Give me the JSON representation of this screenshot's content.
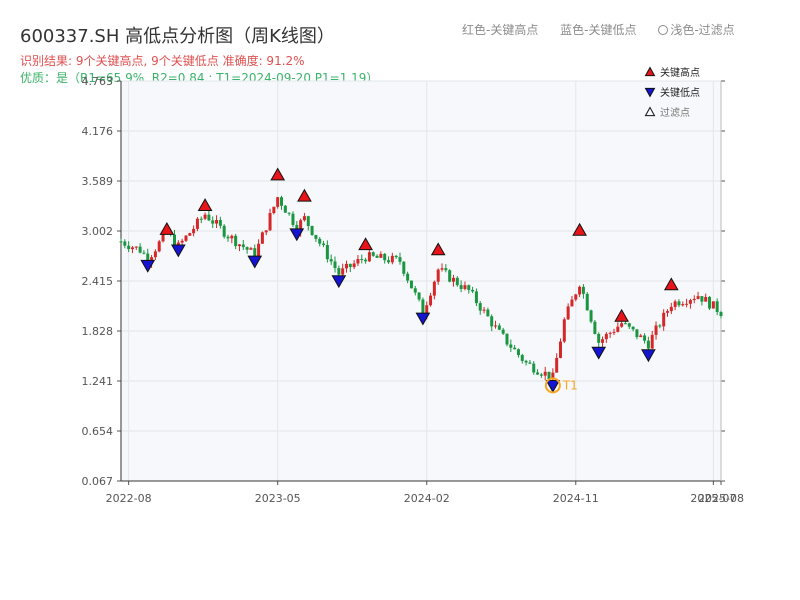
{
  "title": "600337.SH 高低点分析图（周K线图）",
  "subtitle_result": "识别结果: 9个关键高点, 9个关键低点   准确度: 91.2%",
  "subtitle_quality": "优质：是（R1=65.9%, R2=0.84 ; T1=2024-09-20 P1=1.19）",
  "top_legend": {
    "red": "红色-关键高点",
    "blue": "蓝色-关键低点",
    "light": "浅色-过滤点"
  },
  "colors": {
    "up": "#d62728",
    "down": "#1a9641",
    "high": "#e8141a",
    "low": "#1414d2",
    "t1": "#f5a623"
  },
  "chart_data": {
    "type": "candlestick",
    "ylim": [
      0.067,
      4.763
    ],
    "y_ticks": [
      0.067,
      0.654,
      1.241,
      1.828,
      2.415,
      3.002,
      3.589,
      4.176,
      4.763
    ],
    "x_range": [
      "2022-07-22",
      "2025-07-25"
    ],
    "x_ticks": [
      {
        "date": "2022-08-05",
        "label": "2022-08"
      },
      {
        "date": "2023-05-05",
        "label": "2023-05"
      },
      {
        "date": "2024-02-02",
        "label": "2024-02"
      },
      {
        "date": "2024-11-01",
        "label": "2024-11"
      },
      {
        "date": "2025-07-11",
        "label": "2025-07"
      },
      {
        "date": "2025-07-25",
        "label": "2025-08"
      }
    ],
    "legend": [
      {
        "symbol": "triangle-up",
        "label": "关键高点"
      },
      {
        "symbol": "triangle-down",
        "label": "关键低点"
      },
      {
        "symbol": "triangle-up-outline",
        "label": "过滤点"
      }
    ],
    "key_highs": [
      {
        "date": "2022-10-14",
        "value": 3.02
      },
      {
        "date": "2022-12-23",
        "value": 3.3
      },
      {
        "date": "2023-05-05",
        "value": 3.66
      },
      {
        "date": "2023-06-23",
        "value": 3.41
      },
      {
        "date": "2023-10-13",
        "value": 2.84
      },
      {
        "date": "2024-02-23",
        "value": 2.78
      },
      {
        "date": "2024-11-08",
        "value": 3.01
      },
      {
        "date": "2025-01-24",
        "value": 2.0
      },
      {
        "date": "2025-04-25",
        "value": 2.37
      }
    ],
    "key_lows": [
      {
        "date": "2022-09-09",
        "value": 2.6
      },
      {
        "date": "2022-11-04",
        "value": 2.78
      },
      {
        "date": "2023-03-24",
        "value": 2.65
      },
      {
        "date": "2023-06-09",
        "value": 2.97
      },
      {
        "date": "2023-08-25",
        "value": 2.42
      },
      {
        "date": "2024-01-26",
        "value": 1.98
      },
      {
        "date": "2024-09-20",
        "value": 1.19
      },
      {
        "date": "2024-12-13",
        "value": 1.58
      },
      {
        "date": "2025-03-14",
        "value": 1.55
      }
    ],
    "t1": {
      "date": "2024-09-20",
      "value": 1.19,
      "label": "T1"
    },
    "candle_anchors": [
      [
        "2022-07-22",
        2.88
      ],
      [
        "2022-08-26",
        2.78
      ],
      [
        "2022-09-09",
        2.68
      ],
      [
        "2022-10-14",
        2.98
      ],
      [
        "2022-11-04",
        2.82
      ],
      [
        "2022-12-23",
        3.2
      ],
      [
        "2023-02-03",
        2.95
      ],
      [
        "2023-03-24",
        2.72
      ],
      [
        "2023-05-05",
        3.4
      ],
      [
        "2023-06-09",
        3.05
      ],
      [
        "2023-06-23",
        3.15
      ],
      [
        "2023-08-25",
        2.5
      ],
      [
        "2023-10-13",
        2.7
      ],
      [
        "2023-12-15",
        2.65
      ],
      [
        "2024-01-26",
        2.05
      ],
      [
        "2024-02-23",
        2.55
      ],
      [
        "2024-04-19",
        2.3
      ],
      [
        "2024-06-14",
        1.8
      ],
      [
        "2024-08-02",
        1.45
      ],
      [
        "2024-09-20",
        1.28
      ],
      [
        "2024-10-11",
        1.95
      ],
      [
        "2024-11-08",
        2.4
      ],
      [
        "2024-12-13",
        1.7
      ],
      [
        "2025-01-24",
        1.92
      ],
      [
        "2025-03-14",
        1.68
      ],
      [
        "2025-04-25",
        2.15
      ],
      [
        "2025-06-13",
        2.25
      ],
      [
        "2025-07-25",
        2.05
      ]
    ]
  }
}
